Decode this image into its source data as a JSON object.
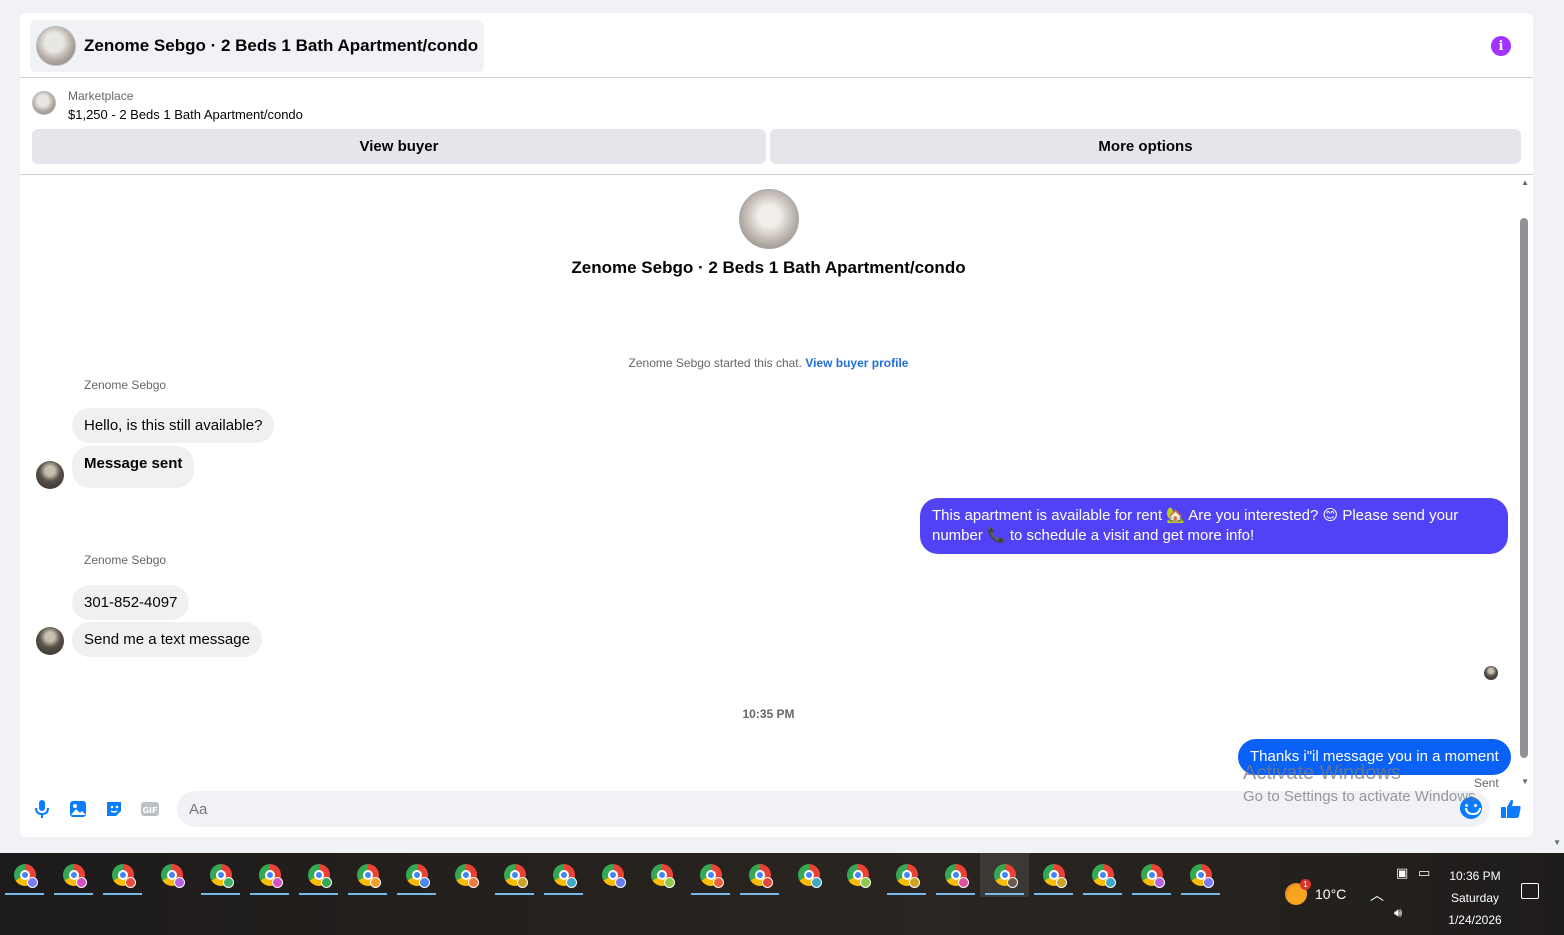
{
  "header": {
    "title": "Zenome Sebgo · 2 Beds 1 Bath Apartment/condo"
  },
  "listing": {
    "label": "Marketplace",
    "price_title": "$1,250 - 2 Beds 1 Bath Apartment/condo",
    "view_buyer_label": "View buyer",
    "more_options_label": "More options"
  },
  "thread": {
    "title": "Zenome Sebgo · 2 Beds 1 Bath Apartment/condo",
    "started_text": "Zenome Sebgo started this chat.",
    "started_link": "View buyer profile",
    "groups": [
      {
        "sender": "Zenome Sebgo",
        "messages": [
          "Hello, is this still available?",
          "Message sent"
        ]
      },
      {
        "sender": "Zenome Sebgo",
        "messages": [
          "301-852-4097",
          "Send me a text message"
        ]
      }
    ],
    "outgoing_1": "This apartment is available for rent 🏡 Are you interested? 😊 Please send your number 📞 to schedule a visit and get more info!",
    "timestamp": "10:35 PM",
    "outgoing_2": "Thanks i\"il message you in a moment",
    "sent_status": "Sent"
  },
  "composer": {
    "placeholder": "Aa",
    "icons": [
      "microphone-icon",
      "photo-icon",
      "sticker-icon",
      "gif-icon",
      "emoji-icon",
      "thumbs-up-icon"
    ],
    "gif_label": "GIF"
  },
  "watermark": {
    "line1": "Activate Windows",
    "line2": "Go to Settings to activate Windows."
  },
  "taskbar": {
    "app_count": 25,
    "weather_temp": "10°C",
    "weather_badge": "1",
    "time": "10:36 PM",
    "day": "Saturday",
    "date": "1/24/2026"
  },
  "colors": {
    "accent_purple": "#a033ff",
    "outgoing_bubble": "#5242f5",
    "outgoing_bubble_blue": "#0a61f5",
    "link": "#216fdb",
    "composer_icon": "#0a7cff"
  }
}
